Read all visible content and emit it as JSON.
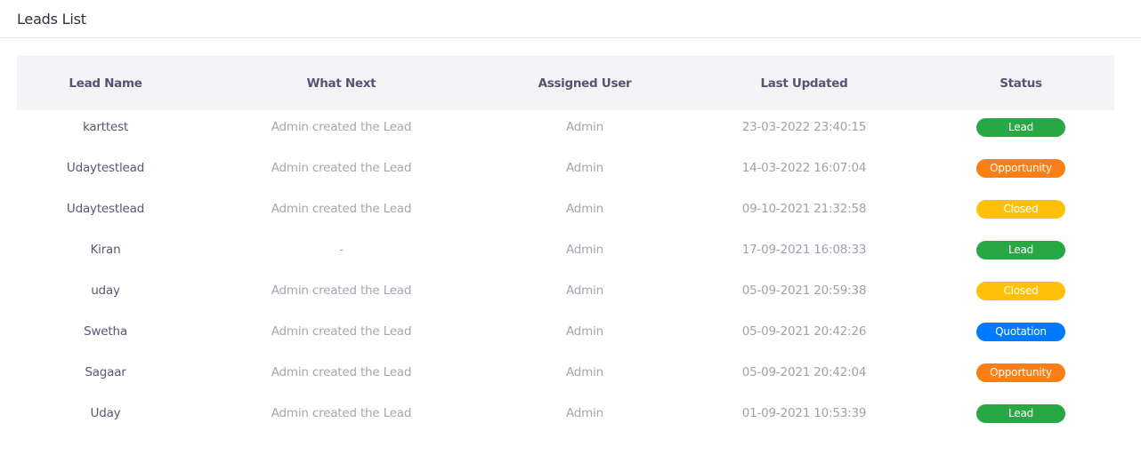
{
  "header": {
    "title": "Leads List"
  },
  "table": {
    "columns": [
      "Lead Name",
      "What Next",
      "Assigned User",
      "Last Updated",
      "Status"
    ],
    "rows": [
      {
        "lead_name": "karttest",
        "what_next": "Admin created the Lead",
        "assigned_user": "Admin",
        "last_updated": "23-03-2022 23:40:15",
        "status": "Lead"
      },
      {
        "lead_name": "Udaytestlead",
        "what_next": "Admin created the Lead",
        "assigned_user": "Admin",
        "last_updated": "14-03-2022 16:07:04",
        "status": "Opportunity"
      },
      {
        "lead_name": "Udaytestlead",
        "what_next": "Admin created the Lead",
        "assigned_user": "Admin",
        "last_updated": "09-10-2021 21:32:58",
        "status": "Closed"
      },
      {
        "lead_name": "Kiran",
        "what_next": "-",
        "assigned_user": "Admin",
        "last_updated": "17-09-2021 16:08:33",
        "status": "Lead"
      },
      {
        "lead_name": "uday",
        "what_next": "Admin created the Lead",
        "assigned_user": "Admin",
        "last_updated": "05-09-2021 20:59:38",
        "status": "Closed"
      },
      {
        "lead_name": "Swetha",
        "what_next": "Admin created the Lead",
        "assigned_user": "Admin",
        "last_updated": "05-09-2021 20:42:26",
        "status": "Quotation"
      },
      {
        "lead_name": "Sagaar",
        "what_next": "Admin created the Lead",
        "assigned_user": "Admin",
        "last_updated": "05-09-2021 20:42:04",
        "status": "Opportunity"
      },
      {
        "lead_name": "Uday",
        "what_next": "Admin created the Lead",
        "assigned_user": "Admin",
        "last_updated": "01-09-2021 10:53:39",
        "status": "Lead"
      }
    ]
  },
  "status_colors": {
    "Lead": "#28a745",
    "Opportunity": "#fd7e14",
    "Closed": "#ffc107",
    "Quotation": "#007bff"
  }
}
